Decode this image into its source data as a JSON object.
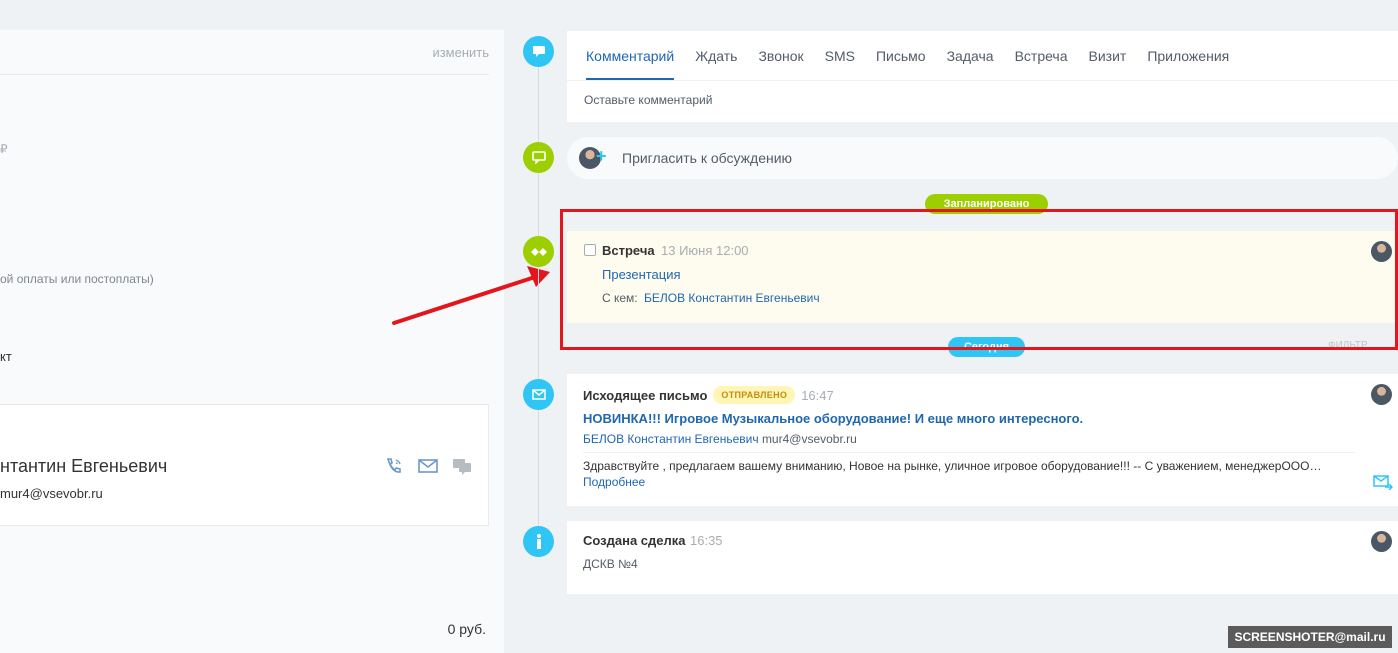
{
  "left": {
    "change_link": "изменить",
    "currency_sign": "₽",
    "payment_text": "ой оплаты или постоплаты)",
    "contact_fragment": "кт",
    "contact_name": "нтантин Евгеньевич",
    "contact_email": "mur4@vsevobr.ru",
    "sum": "0 руб."
  },
  "editor": {
    "tabs": [
      "Комментарий",
      "Ждать",
      "Звонок",
      "SMS",
      "Письмо",
      "Задача",
      "Встреча",
      "Визит",
      "Приложения"
    ],
    "placeholder": "Оставьте комментарий"
  },
  "invite": {
    "text": "Пригласить к обсуждению"
  },
  "badges": {
    "planned": "Запланировано",
    "history": "Сегодня"
  },
  "meeting": {
    "title": "Встреча",
    "date": "13 Июня 12:00",
    "subject": "Презентация",
    "with_label": "С кем:",
    "with_name": "БЕЛОВ Константин Евгеньевич"
  },
  "filter": "ФИЛЬТР",
  "email": {
    "title": "Исходящее письмо",
    "status": "ОТПРАВЛЕНО",
    "time": "16:47",
    "subject": "НОВИНКА!!! Игровое Музыкальное оборудование! И еще много интересного.",
    "from_name": "БЕЛОВ Константин Евгеньевич",
    "from_addr": "mur4@vsevobr.ru",
    "body": "Здравствуйте , предлагаем вашему вниманию, Новое на рынке,  уличное игровое оборудование!!! -- С уважением, менеджерООО…",
    "more": "Подробнее"
  },
  "created": {
    "title": "Создана сделка",
    "time": "16:35",
    "subtitle": "ДСКВ №4"
  },
  "watermark": "SCREENSHOTER@mail.ru",
  "colors": {
    "accent": "#2067b0",
    "blue": "#2fc6f6",
    "green": "#9dcf00",
    "highlight": "#e2161c"
  }
}
